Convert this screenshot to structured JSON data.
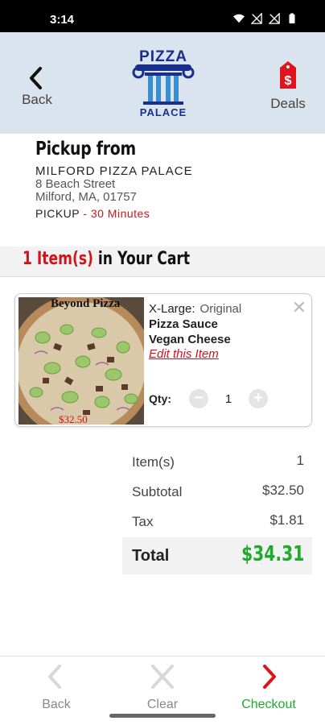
{
  "status": {
    "time": "3:14"
  },
  "header": {
    "back_label": "Back",
    "deals_label": "Deals",
    "logo_top": "PIZZA",
    "logo_bottom": "PALACE"
  },
  "pickup": {
    "title": "Pickup from",
    "store_name": "MILFORD PIZZA PALACE",
    "address_line1": "8 Beach Street",
    "address_line2": "Milford, MA, 01757",
    "method": "PICKUP",
    "separator": " - ",
    "time": "30 Minutes"
  },
  "cart": {
    "count_text": "1 Item(s)",
    "suffix": " in Your Cart"
  },
  "item": {
    "image_title": "Beyond Pizza",
    "image_price": "$32.50",
    "size": "X-Large:",
    "crust": "Original",
    "toppings": [
      "Pizza Sauce",
      "Vegan Cheese"
    ],
    "edit_label": "Edit this Item",
    "qty_label": "Qty:",
    "qty_value": "1",
    "close_symbol": "✕",
    "minus_symbol": "−",
    "plus_symbol": "+"
  },
  "totals": {
    "items_label": "Item(s)",
    "items_value": "1",
    "subtotal_label": "Subtotal",
    "subtotal_value": "$32.50",
    "tax_label": "Tax",
    "tax_value": "$1.81",
    "total_label": "Total",
    "total_value": "$34.31"
  },
  "bottom_nav": {
    "back": "Back",
    "clear": "Clear",
    "checkout": "Checkout"
  },
  "colors": {
    "accent_red": "#d0141e",
    "accent_green": "#1faa2e",
    "header_bg": "#d9e4ef",
    "logo_blue": "#1a2e8c"
  },
  "icons": [
    "wifi-icon",
    "signal-icon",
    "battery-icon",
    "chevron-left-icon",
    "price-tag-icon",
    "close-icon",
    "minus-icon",
    "plus-icon",
    "chevron-right-icon"
  ]
}
